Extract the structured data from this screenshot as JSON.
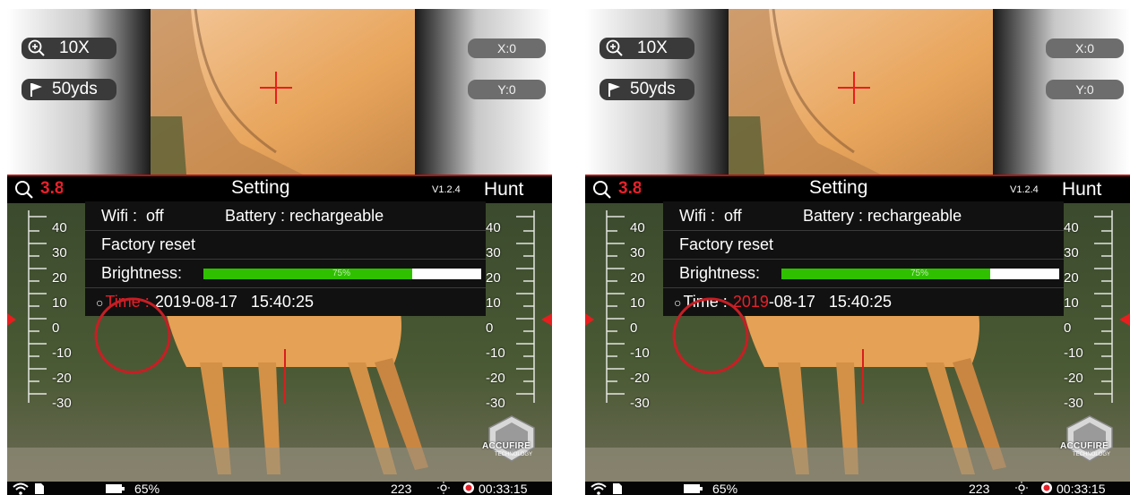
{
  "colors": {
    "accent_red": "#e8202a",
    "progress_green": "#2fc000",
    "bar_black": "#000000"
  },
  "screens": [
    {
      "zoom_label": "10X",
      "distance_label": "50yds",
      "x_offset": "X:0",
      "y_offset": "Y:0",
      "zoom_readout": "3.8",
      "menu_title": "Setting",
      "version": "V1.2.4",
      "mode": "Hunt",
      "wifi": "Wifi :  off",
      "battery": "Battery : rechargeable",
      "factory_reset": "Factory reset",
      "brightness_label": "Brightness:",
      "brightness_value": "75%",
      "brightness_fraction": 0.75,
      "time_bullet": "○",
      "time_label": "Time :",
      "time_year": "2019",
      "time_rest": "-08-17   15:40:25",
      "time_highlight": "label",
      "scale_left": [
        "40",
        "30",
        "20",
        "10",
        "0",
        "-10",
        "-20",
        "-30"
      ],
      "scale_right": [
        "40",
        "30",
        "20",
        "10",
        "0",
        "-10",
        "-20",
        "-30"
      ],
      "status_battery": "65%",
      "status_count": "223",
      "status_timer": "00:33:15",
      "logo_text": "ACCUFIRE",
      "logo_sub": "TECHNOLOGY"
    },
    {
      "zoom_label": "10X",
      "distance_label": "50yds",
      "x_offset": "X:0",
      "y_offset": "Y:0",
      "zoom_readout": "3.8",
      "menu_title": "Setting",
      "version": "V1.2.4",
      "mode": "Hunt",
      "wifi": "Wifi :  off",
      "battery": "Battery : rechargeable",
      "factory_reset": "Factory reset",
      "brightness_label": "Brightness:",
      "brightness_value": "75%",
      "brightness_fraction": 0.75,
      "time_bullet": "○",
      "time_label": "Time :",
      "time_year": "2019",
      "time_rest": "-08-17   15:40:25",
      "time_highlight": "year",
      "scale_left": [
        "40",
        "30",
        "20",
        "10",
        "0",
        "-10",
        "-20",
        "-30"
      ],
      "scale_right": [
        "40",
        "30",
        "20",
        "10",
        "0",
        "-10",
        "-20",
        "-30"
      ],
      "status_battery": "65%",
      "status_count": "223",
      "status_timer": "00:33:15",
      "logo_text": "ACCUFIRE",
      "logo_sub": "TECHNOLOGY"
    }
  ]
}
